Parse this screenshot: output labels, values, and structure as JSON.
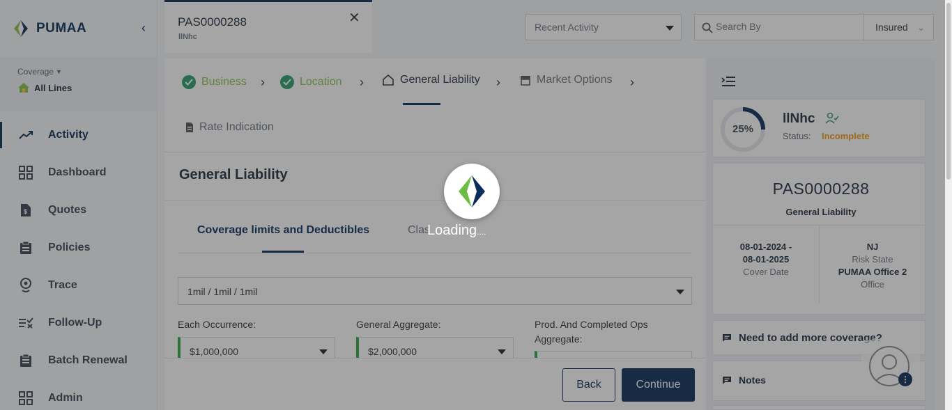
{
  "app": {
    "brand": "PUMAA"
  },
  "sidebar": {
    "coverage_label": "Coverage",
    "coverage_value": "All Lines",
    "items": [
      {
        "label": "Activity",
        "icon": "trend-up-icon"
      },
      {
        "label": "Dashboard",
        "icon": "grid-icon"
      },
      {
        "label": "Quotes",
        "icon": "quote-doc-icon"
      },
      {
        "label": "Policies",
        "icon": "clipboard-icon"
      },
      {
        "label": "Trace",
        "icon": "location-pin-icon"
      },
      {
        "label": "Follow-Up",
        "icon": "checklist-icon"
      },
      {
        "label": "Batch Renewal",
        "icon": "clipboard-list-icon"
      },
      {
        "label": "Admin",
        "icon": "grid-icon"
      }
    ]
  },
  "header": {
    "tab_title": "PAS0000288",
    "tab_subtitle": "llNhc",
    "recent_activity": "Recent Activity",
    "search_placeholder": "Search By",
    "search_filter": "Insured"
  },
  "steps": [
    {
      "label": "Business",
      "state": "done"
    },
    {
      "label": "Location",
      "state": "done"
    },
    {
      "label": "General Liability",
      "state": "current"
    },
    {
      "label": "Market Options",
      "state": "todo"
    },
    {
      "label": "Rate Indication",
      "state": "todo"
    }
  ],
  "main": {
    "section_title": "General Liability",
    "subtab_active": "Coverage limits and Deductibles",
    "subtab_other": "Clas",
    "limits_value": "1mil / 1mil / 1mil",
    "fields": [
      {
        "label": "Each Occurrence:",
        "value": "$1,000,000"
      },
      {
        "label": "General Aggregate:",
        "value": "$2,000,000"
      },
      {
        "label": "Prod. And Completed Ops Aggregate:",
        "value": ""
      }
    ],
    "back_label": "Back",
    "continue_label": "Continue"
  },
  "summary": {
    "progress_text": "25%",
    "progress_fraction": 0.25,
    "insured_name": "llNhc",
    "status_label": "Status:",
    "status_value": "Incomplete",
    "policy_number": "PAS0000288",
    "line": "General Liability",
    "cover_date_start": "08-01-2024 -",
    "cover_date_end": "08-01-2025",
    "cover_date_label": "Cover Date",
    "risk_state": "NJ",
    "risk_state_label": "Risk State",
    "office": "PUMAA Office 2",
    "office_label": "Office",
    "more_coverage": "Need to add more coverage?",
    "notes": "Notes"
  },
  "loading": {
    "text": "Loading"
  },
  "colors": {
    "brand_navy": "#0c2d5b",
    "done_green": "#8bc34a",
    "status_orange": "#f39c12",
    "field_accent": "#2eaa3e"
  }
}
